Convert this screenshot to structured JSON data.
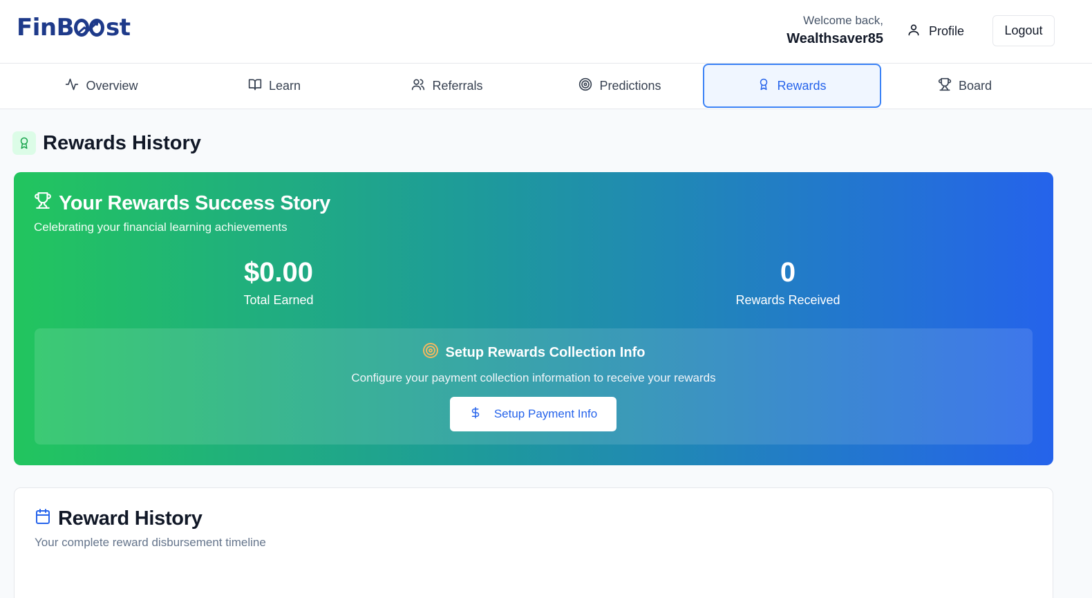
{
  "header": {
    "logo_prefix": "FinB",
    "logo_suffix": "st",
    "welcome_text": "Welcome back,",
    "username": "Wealthsaver85",
    "profile_label": "Profile",
    "logout_label": "Logout"
  },
  "tabs": [
    {
      "label": "Overview",
      "icon": "activity-icon",
      "active": false
    },
    {
      "label": "Learn",
      "icon": "book-open-icon",
      "active": false
    },
    {
      "label": "Referrals",
      "icon": "users-icon",
      "active": false
    },
    {
      "label": "Predictions",
      "icon": "target-icon",
      "active": false
    },
    {
      "label": "Rewards",
      "icon": "award-icon",
      "active": true
    },
    {
      "label": "Board",
      "icon": "trophy-icon",
      "active": false
    }
  ],
  "page": {
    "title": "Rewards History"
  },
  "hero": {
    "title": "Your Rewards Success Story",
    "subtitle": "Celebrating your financial learning achievements",
    "total_earned_value": "$0.00",
    "total_earned_label": "Total Earned",
    "rewards_received_value": "0",
    "rewards_received_label": "Rewards Received",
    "setup_title": "Setup Rewards Collection Info",
    "setup_description": "Configure your payment collection information to receive your rewards",
    "setup_button_label": "Setup Payment Info"
  },
  "history": {
    "title": "Reward History",
    "subtitle": "Your complete reward disbursement timeline"
  },
  "colors": {
    "brand": "#1e3a8a",
    "accent": "#2563eb",
    "gradient_start": "#22c55e",
    "gradient_end": "#2563eb",
    "active_tab_border": "#3b82f6"
  }
}
